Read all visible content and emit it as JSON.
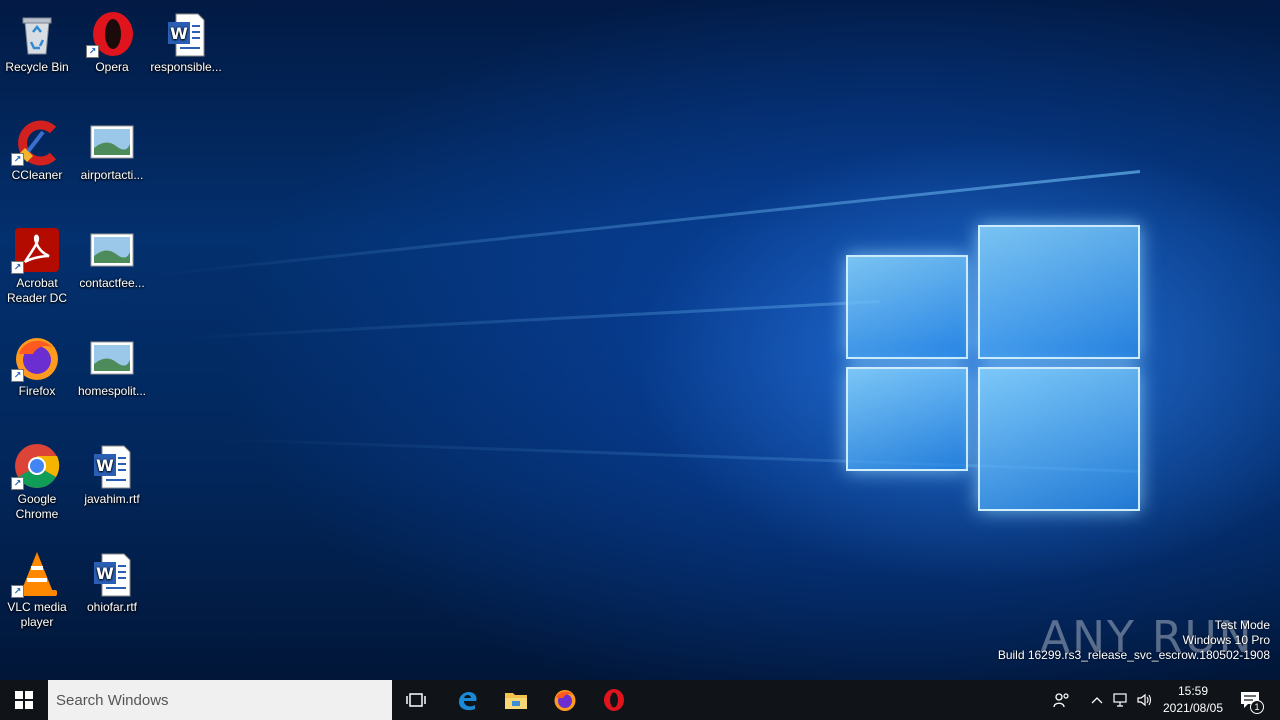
{
  "desktop": {
    "icons": [
      {
        "label": "Recycle Bin",
        "icon": "recycle-bin-icon",
        "shortcut": false
      },
      {
        "label": "Opera",
        "icon": "opera-icon",
        "shortcut": true
      },
      {
        "label": "responsible...",
        "icon": "word-document-icon",
        "shortcut": false
      },
      {
        "label": "CCleaner",
        "icon": "ccleaner-icon",
        "shortcut": true
      },
      {
        "label": "airportacti...",
        "icon": "image-file-icon",
        "shortcut": false
      },
      {
        "label": "Acrobat Reader DC",
        "icon": "acrobat-icon",
        "shortcut": true
      },
      {
        "label": "contactfee...",
        "icon": "image-file-icon",
        "shortcut": false
      },
      {
        "label": "Firefox",
        "icon": "firefox-icon",
        "shortcut": true
      },
      {
        "label": "homespolit...",
        "icon": "image-file-icon",
        "shortcut": false
      },
      {
        "label": "Google Chrome",
        "icon": "chrome-icon",
        "shortcut": true
      },
      {
        "label": "javahim.rtf",
        "icon": "word-document-icon",
        "shortcut": false
      },
      {
        "label": "VLC media player",
        "icon": "vlc-icon",
        "shortcut": true
      },
      {
        "label": "ohiofar.rtf",
        "icon": "word-document-icon",
        "shortcut": false
      }
    ],
    "watermark": {
      "line1": "Test Mode",
      "line2": "Windows 10 Pro",
      "line3": "Build 16299.rs3_release_svc_escrow.180502-1908"
    },
    "brand_watermark": "ANY RUN"
  },
  "taskbar": {
    "search_placeholder": "Search Windows",
    "pinned": [
      "task-view-icon",
      "edge-icon",
      "file-explorer-icon",
      "firefox-icon",
      "opera-icon"
    ],
    "clock_time": "15:59",
    "clock_date": "2021/08/05",
    "notification_count": "1"
  },
  "colors": {
    "taskbar": "#101418",
    "accent": "#1a8ad8"
  }
}
